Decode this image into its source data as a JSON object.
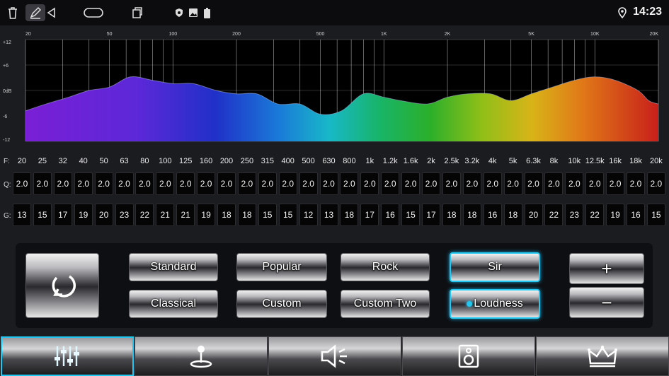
{
  "status_bar": {
    "time": "14:23",
    "icons": [
      "trash-icon",
      "pencil-icon",
      "back-triangle-icon",
      "home-pill-icon",
      "recents-icon",
      "shield-icon",
      "image-icon",
      "battery-icon",
      "location-pin-icon"
    ]
  },
  "spectrum": {
    "top_freq_labels": [
      "20",
      "50",
      "100",
      "200",
      "500",
      "1K",
      "2K",
      "5K",
      "10K",
      "20K"
    ],
    "db_labels": [
      "+12",
      "+6",
      "0dB",
      "-6",
      "-12"
    ]
  },
  "bands": {
    "freq_label": "F:",
    "q_label": "Q:",
    "g_label": "G:",
    "frequencies": [
      "20",
      "25",
      "32",
      "40",
      "50",
      "63",
      "80",
      "100",
      "125",
      "160",
      "200",
      "250",
      "315",
      "400",
      "500",
      "630",
      "800",
      "1k",
      "1.2k",
      "1.6k",
      "2k",
      "2.5k",
      "3.2k",
      "4k",
      "5k",
      "6.3k",
      "8k",
      "10k",
      "12.5k",
      "16k",
      "18k",
      "20k"
    ],
    "q_values": [
      "2.0",
      "2.0",
      "2.0",
      "2.0",
      "2.0",
      "2.0",
      "2.0",
      "2.0",
      "2.0",
      "2.0",
      "2.0",
      "2.0",
      "2.0",
      "2.0",
      "2.0",
      "2.0",
      "2.0",
      "2.0",
      "2.0",
      "2.0",
      "2.0",
      "2.0",
      "2.0",
      "2.0",
      "2.0",
      "2.0",
      "2.0",
      "2.0",
      "2.0",
      "2.0",
      "2.0",
      "2.0"
    ],
    "g_values": [
      "13",
      "15",
      "17",
      "19",
      "20",
      "23",
      "22",
      "21",
      "21",
      "19",
      "18",
      "18",
      "15",
      "15",
      "12",
      "13",
      "18",
      "17",
      "16",
      "15",
      "17",
      "18",
      "18",
      "16",
      "18",
      "20",
      "22",
      "23",
      "22",
      "19",
      "16",
      "15"
    ]
  },
  "controls": {
    "presets": {
      "standard": "Standard",
      "popular": "Popular",
      "rock": "Rock",
      "sir": "Sir",
      "classical": "Classical",
      "custom": "Custom",
      "custom_two": "Custom Two",
      "loudness": "Loudness"
    },
    "active_preset": "Sir",
    "loudness_on": true,
    "plus": "+",
    "minus": "−"
  },
  "nav": {
    "tabs": [
      "equalizer-icon",
      "joystick-icon",
      "speaker-icon",
      "subwoofer-icon",
      "crown-icon"
    ],
    "active": 0
  },
  "colors": {
    "accent": "#23c8f0"
  }
}
